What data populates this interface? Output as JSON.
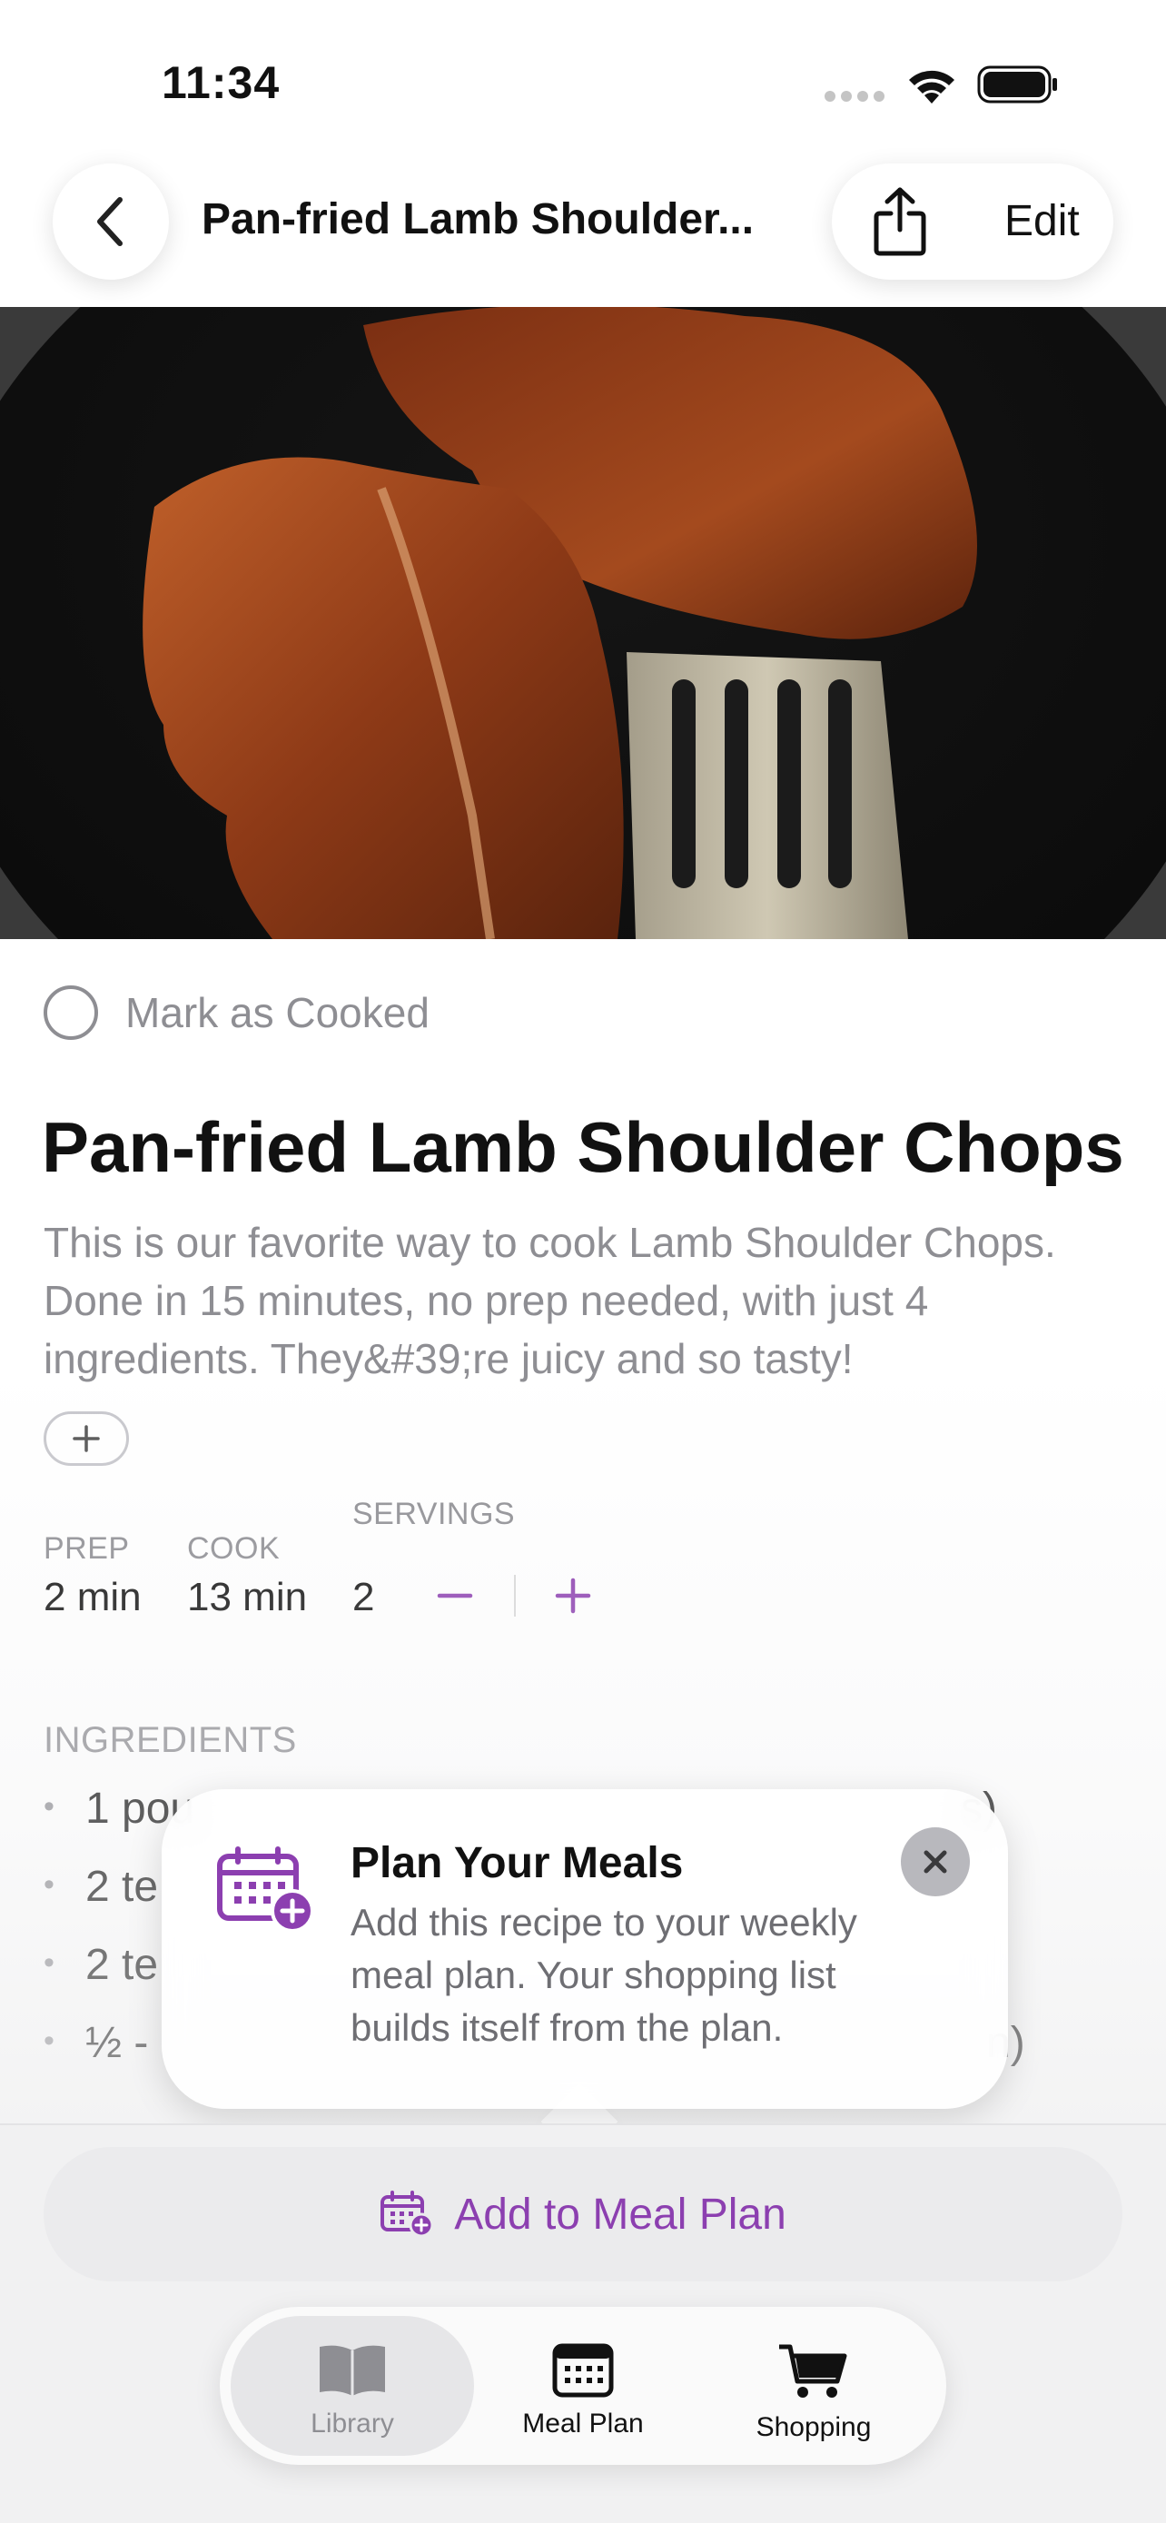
{
  "status_bar": {
    "time": "11:34"
  },
  "nav": {
    "title": "Pan-fried Lamb Shoulder...",
    "edit_label": "Edit"
  },
  "cooked": {
    "label": "Mark as Cooked"
  },
  "recipe": {
    "title": "Pan-fried Lamb Shoulder Chops",
    "description": "This is our favorite way to cook Lamb Shoulder Chops. Done in 15 minutes, no prep needed, with just 4 ingredients. They&#39;re juicy and so tasty!"
  },
  "stats": {
    "prep_label": "PREP",
    "prep_value": "2 min",
    "cook_label": "COOK",
    "cook_value": "13 min",
    "servings_label": "SERVINGS",
    "servings_value": "2"
  },
  "ingredients": {
    "header": "INGREDIENTS",
    "items": [
      "1 pou",
      "2 te",
      "2 te",
      "½ -"
    ],
    "visible_fragments": [
      "s)",
      "n)"
    ]
  },
  "tip": {
    "title": "Plan Your Meals",
    "body": "Add this recipe to your weekly meal plan. Your shopping list builds itself from the plan."
  },
  "meal_plan_button": {
    "label": "Add to Meal Plan"
  },
  "tabs": [
    {
      "label": "Library",
      "active": true
    },
    {
      "label": "Meal Plan",
      "active": false
    },
    {
      "label": "Shopping",
      "active": false
    }
  ],
  "colors": {
    "accent": "#8c3fb0",
    "secondary_text": "#8e8e93"
  },
  "icons": [
    "back-chevron-icon",
    "share-icon",
    "calendar-add-icon",
    "close-icon",
    "book-icon",
    "calendar-icon",
    "cart-icon",
    "plus-icon",
    "minus-icon",
    "wifi-icon",
    "battery-icon",
    "signal-icon"
  ]
}
